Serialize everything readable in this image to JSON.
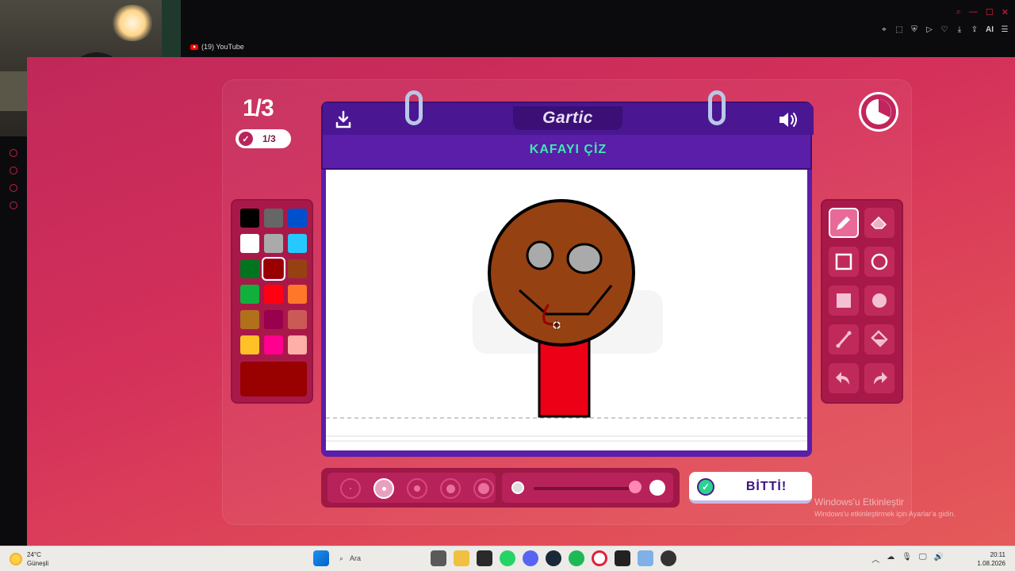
{
  "browser": {
    "tab_title": "(19) YouTube",
    "toolbar_icons": [
      "pin-icon",
      "screenshot-icon",
      "shield-icon",
      "play-icon",
      "heart-icon",
      "download-icon",
      "share-icon",
      "aria-icon",
      "menu-icon"
    ],
    "ai_label": "AI"
  },
  "game": {
    "round_label": "1/3",
    "done_count_label": "1/3",
    "logo": "Gartic",
    "prompt": "KAFAYI ÇİZ",
    "done_button_label": "BİTTİ!",
    "palette": {
      "colors": [
        "#000000",
        "#666666",
        "#0050cd",
        "#ffffff",
        "#aaaaaa",
        "#26c9ff",
        "#017420",
        "#990000",
        "#964112",
        "#11b03c",
        "#ff0013",
        "#ff7829",
        "#b0701c",
        "#99004e",
        "#cb5a57",
        "#ffc126",
        "#ff008f",
        "#feafa8"
      ],
      "selected_index": 7,
      "current_color": "#990000"
    },
    "tools": [
      "pencil-icon",
      "eraser-icon",
      "rectangle-outline-icon",
      "circle-outline-icon",
      "rectangle-filled-icon",
      "circle-filled-icon",
      "line-icon",
      "fill-bucket-icon",
      "undo-icon",
      "redo-icon"
    ],
    "active_tool_index": 0,
    "brush_sizes_count": 5,
    "active_brush_size_index": 1,
    "opacity_level_percent": 100
  },
  "watermark": {
    "title": "Windows'u Etkinleştir",
    "subtitle": "Windows'u etkinleştirmek için Ayarlar'a gidin."
  },
  "taskbar": {
    "temperature": "24°C",
    "weather": "Güneşli",
    "search_placeholder": "Ara",
    "time": "20:11",
    "date": "1.08.2026"
  }
}
